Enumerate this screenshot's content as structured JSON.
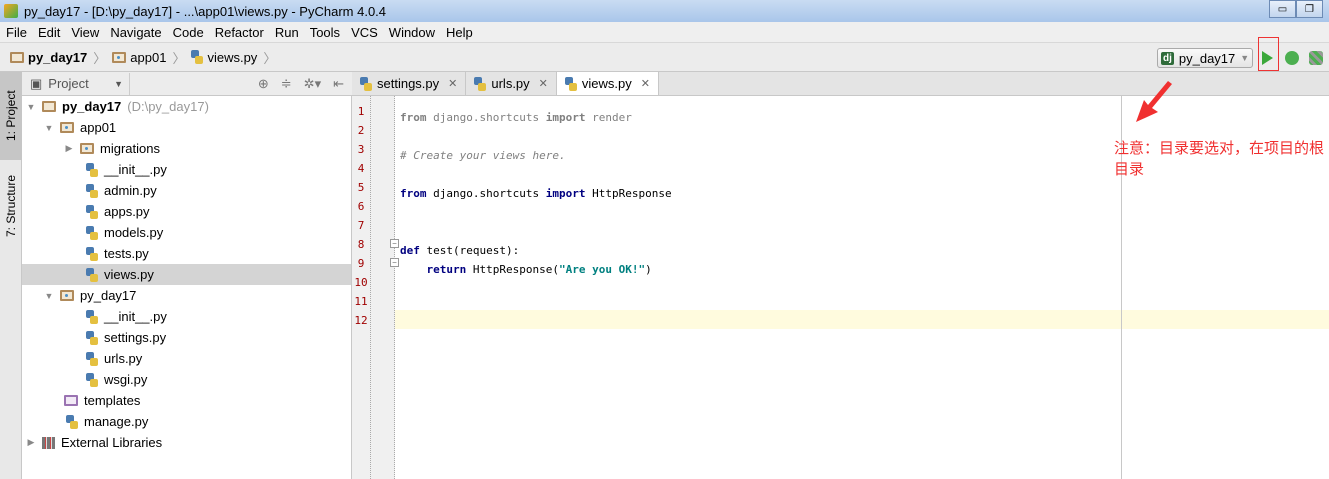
{
  "window": {
    "title": "py_day17 - [D:\\py_day17] - ...\\app01\\views.py - PyCharm 4.0.4",
    "minimize": "▭",
    "restore": "❐"
  },
  "menu": [
    "File",
    "Edit",
    "View",
    "Navigate",
    "Code",
    "Refactor",
    "Run",
    "Tools",
    "VCS",
    "Window",
    "Help"
  ],
  "breadcrumb": [
    "py_day17",
    "app01",
    "views.py"
  ],
  "run_config": {
    "badge": "dj",
    "name": "py_day17"
  },
  "side_tabs": {
    "project": "1: Project",
    "structure": "7: Structure"
  },
  "project_panel": {
    "dropdown": "Project"
  },
  "tree": {
    "root": {
      "name": "py_day17",
      "path": "(D:\\py_day17)"
    },
    "app01": "app01",
    "migrations": "migrations",
    "app01_files": [
      "__init__.py",
      "admin.py",
      "apps.py",
      "models.py",
      "tests.py",
      "views.py"
    ],
    "pkg": "py_day17",
    "pkg_files": [
      "__init__.py",
      "settings.py",
      "urls.py",
      "wsgi.py"
    ],
    "templates": "templates",
    "manage": "manage.py",
    "ext": "External Libraries"
  },
  "tabs": [
    "settings.py",
    "urls.py",
    "views.py"
  ],
  "code": {
    "l1": {
      "kw1": "from",
      "mod": " django.shortcuts ",
      "kw2": "import",
      "name": " render"
    },
    "l3": "# Create your views here.",
    "l5": {
      "kw1": "from",
      "mod": " django.shortcuts ",
      "kw2": "import",
      "name": " HttpResponse"
    },
    "l8": {
      "kw": "def",
      "rest": " test(request):"
    },
    "l9": {
      "indent": "    ",
      "kw": "return",
      "call": " HttpResponse(",
      "str": "\"Are you OK!\"",
      "end": ")"
    }
  },
  "line_numbers": [
    "1",
    "2",
    "3",
    "4",
    "5",
    "6",
    "7",
    "8",
    "9",
    "10",
    "11",
    "12"
  ],
  "annotation": "注意：目录要选对，在项目的根目录",
  "colors": {
    "annotation": "#f03030",
    "run": "#3aa83a"
  }
}
